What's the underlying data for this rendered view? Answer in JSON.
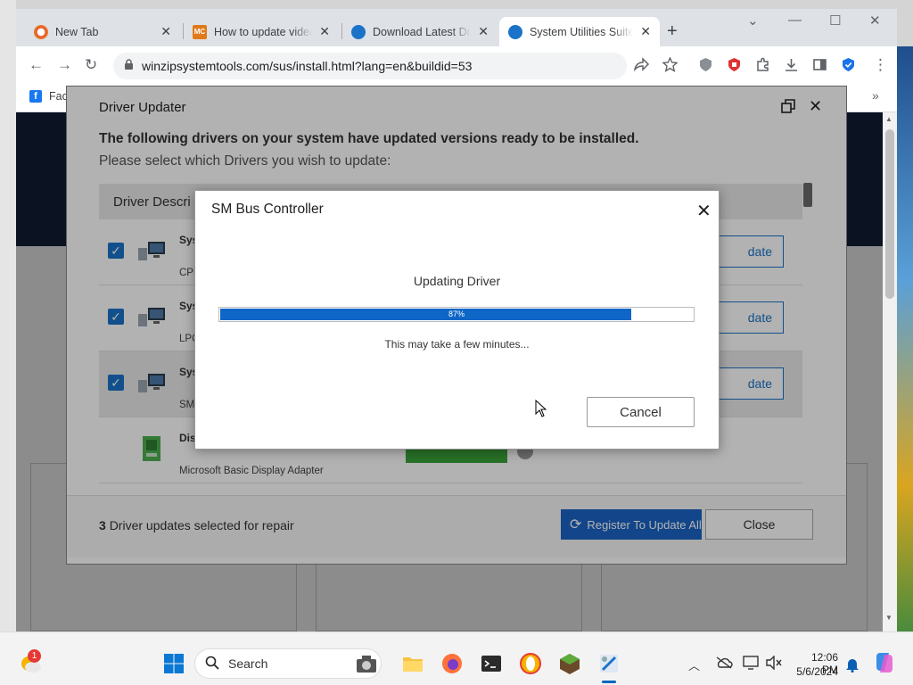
{
  "browser": {
    "tabs": [
      {
        "title": "New Tab",
        "icon": "opera-logo",
        "active": false
      },
      {
        "title": "How to update video driver",
        "icon": "mc-logo",
        "active": false
      },
      {
        "title": "Download Latest Driver",
        "icon": "sus-logo",
        "active": false
      },
      {
        "title": "System Utilities Suite",
        "icon": "sus-logo",
        "active": true
      }
    ],
    "url": "winzipsystemtools.com/sus/install.html?lang=en&buildid=53",
    "bookmark_label": "Fac"
  },
  "driver_updater": {
    "title": "Driver Updater",
    "heading": "The following drivers on your system have updated versions ready to be installed.",
    "subheading": "Please select which Drivers you wish to update:",
    "column_description": "Driver Descri",
    "rows": [
      {
        "name": "Sys",
        "sub": "CPU",
        "checked": true,
        "button": "date"
      },
      {
        "name": "Sys",
        "sub": "LPC",
        "checked": true,
        "button": "date"
      },
      {
        "name": "Sys",
        "sub": "SM",
        "checked": true,
        "button": "date"
      },
      {
        "name": "Dis",
        "sub": "Microsoft Basic Display Adapter",
        "checked": false,
        "button": ""
      }
    ],
    "count_number": "3",
    "count_text": "Driver updates selected for repair",
    "register_button": "Register To Update All",
    "close_button": "Close"
  },
  "modal": {
    "title": "SM Bus Controller",
    "status": "Updating Driver",
    "progress_label": "87%",
    "progress_fraction": 0.87,
    "note": "This may take a few minutes...",
    "cancel_button": "Cancel"
  },
  "taskbar": {
    "search_label": "Search",
    "time": "12:06 PM",
    "date": "5/6/2024",
    "weather_badge": "1"
  },
  "colors": {
    "accent": "#1a73c9",
    "progress": "#0e66c7",
    "register": "#1a63c4"
  }
}
